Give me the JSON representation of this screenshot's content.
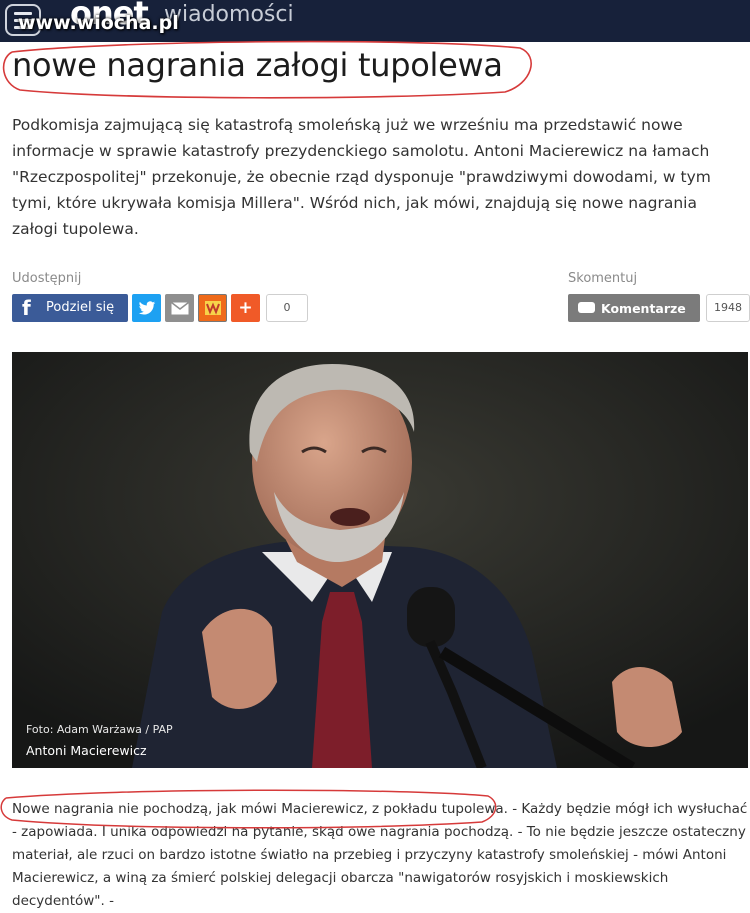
{
  "header": {
    "logo": "onet",
    "section": "wiadomości",
    "watermark": "www.wiocha.pl"
  },
  "article": {
    "title": "nowe nagrania załogi tupolewa",
    "lead": "Podkomisja zajmującą się katastrofą smoleńską już we wrześniu ma przedstawić nowe informacje w sprawie katastrofy prezydenckiego samolotu. Antoni Macierewicz na łamach \"Rzeczpospolitej\" przekonuje, że obecnie rząd dysponuje \"prawdziwymi dowodami, w tym tymi, które ukrywała komisja Millera\". Wśród nich, jak mówi, znajdują się nowe nagrania załogi tupolewa.",
    "photo_credit": "Foto: Adam Warżawa / PAP",
    "photo_caption": "Antoni Macierewicz",
    "body_highlight": "Nowe nagrania nie pochodzą, jak mówi Macierewicz, z pokładu tupolewa.",
    "body_rest": " - Każdy będzie mógł ich wysłuchać - zapowiada. I unika odpowiedzi na pytanie, skąd owe nagrania pochodzą. - To nie będzie jeszcze ostateczny materiał, ale rzuci on bardzo istotne światło na przebieg i przyczyny katastrofy smoleńskiej - mówi Antoni Macierewicz, a winą za śmierć polskiej delegacji obarcza \"nawigatorów rosyjskich i moskiewskich decydentów\". -"
  },
  "share": {
    "label": "Udostępnij",
    "facebook_label": "Podziel się",
    "count": "0",
    "icons": [
      "facebook-icon",
      "twitter-icon",
      "email-icon",
      "wykop-icon",
      "plus-icon"
    ],
    "colors": {
      "facebook": "#3b5b98",
      "twitter": "#1da1f2",
      "email": "#8f8f8f",
      "wykop": "#ef6a1a",
      "plus": "#f05a28"
    }
  },
  "comments": {
    "label": "Skomentuj",
    "button_label": "Komentarze",
    "count": "1948"
  },
  "colors": {
    "topbar": "#17213a",
    "highlight": "#d63a3a"
  }
}
